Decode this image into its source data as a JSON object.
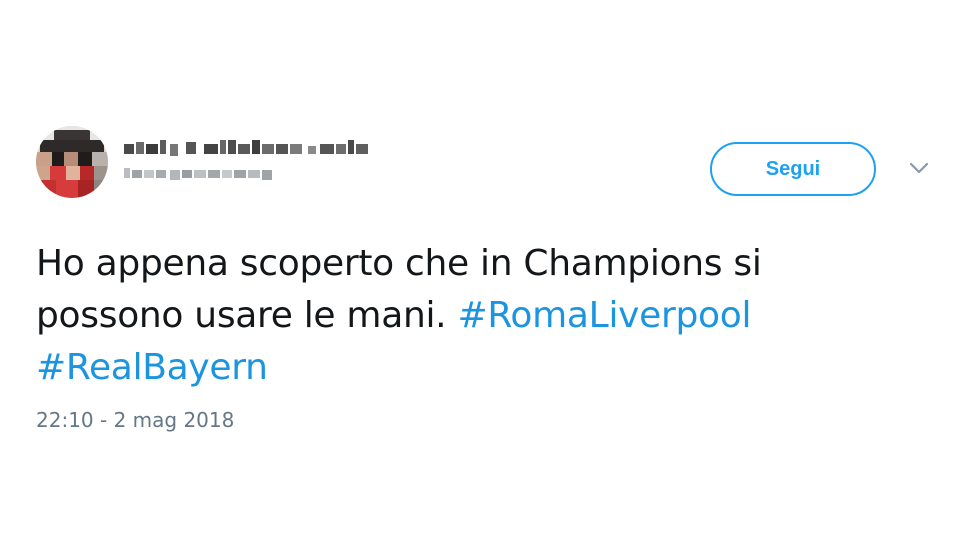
{
  "tweet": {
    "follow_label": "Segui",
    "text_part1": "Ho appena scoperto che in Champions si",
    "text_part2": "possono usare le mani. ",
    "hashtag1": "#RomaLiverpool",
    "hashtag2": "#RealBayern",
    "timestamp": "22:10 - 2 mag 2018"
  },
  "icons": {
    "menu": "chevron-down-icon",
    "avatar": "pixelated-avatar"
  },
  "colors": {
    "accent": "#1da1f2",
    "hashtag": "#1b95e0",
    "text": "#14171a",
    "muted": "#657786",
    "background": "#ffffff"
  }
}
